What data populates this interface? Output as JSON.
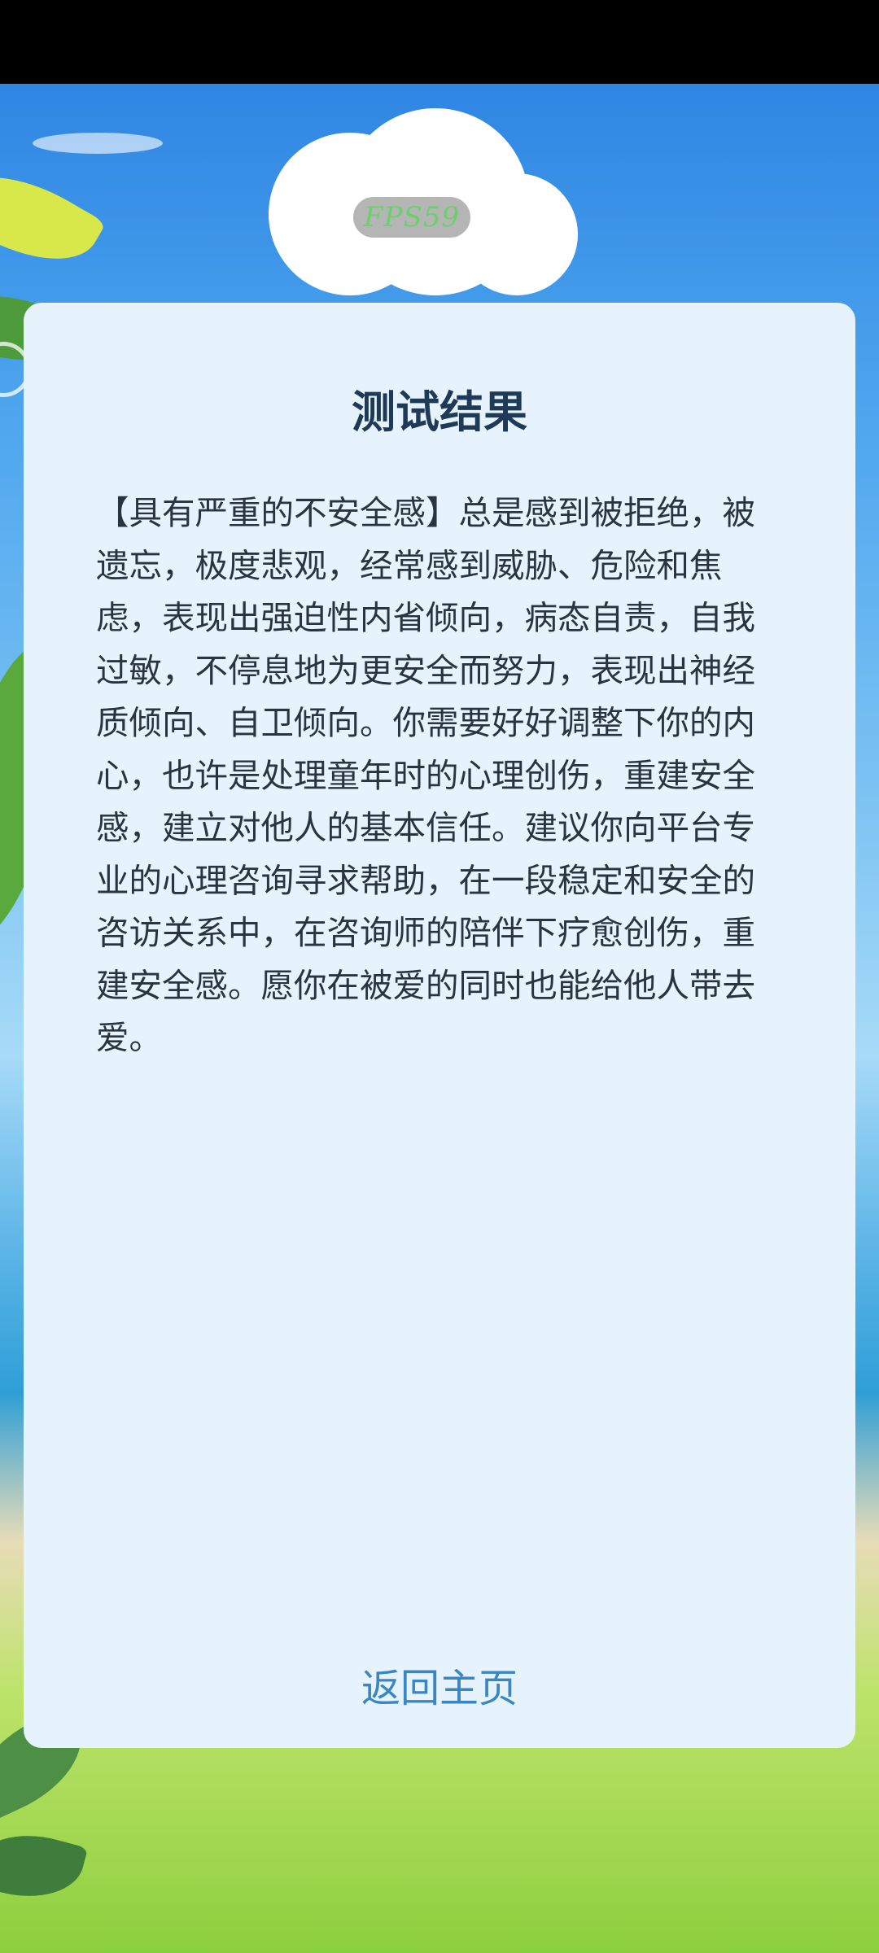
{
  "overlay": {
    "fps_label": "FPS59"
  },
  "result": {
    "title": "测试结果",
    "description": "【具有严重的不安全感】总是感到被拒绝，被遗忘，极度悲观，经常感到威胁、危险和焦虑，表现出强迫性内省倾向，病态自责，自我过敏，不停息地为更安全而努力，表现出神经质倾向、自卫倾向。你需要好好调整下你的内心，也许是处理童年时的心理创伤，重建安全感，建立对他人的基本信任。建议你向平台专业的心理咨询寻求帮助，在一段稳定和安全的咨访关系中，在咨询师的陪伴下疗愈创伤，重建安全感。愿你在被爱的同时也能给他人带去爱。",
    "back_home_label": "返回主页"
  },
  "colors": {
    "card_background": "#e6f3fc",
    "title_color": "#1f3a57",
    "link_color": "#3a86c3"
  }
}
